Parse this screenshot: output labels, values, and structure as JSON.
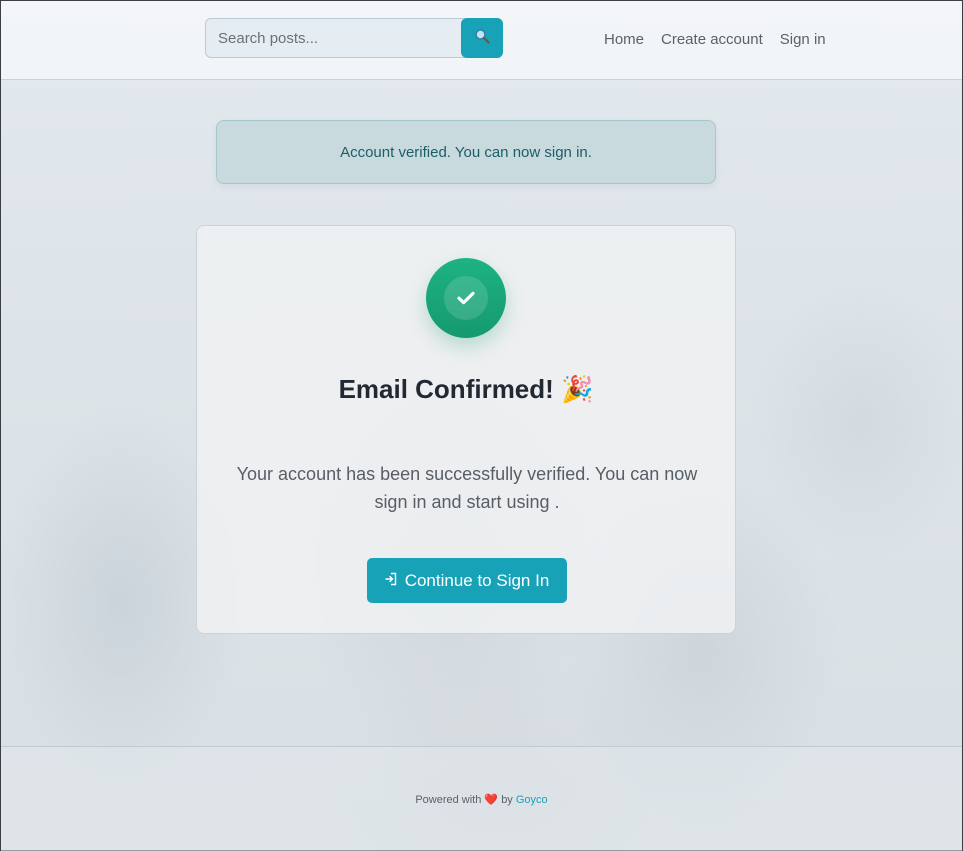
{
  "header": {
    "search": {
      "placeholder": "Search posts...",
      "button_icon": "search-icon"
    },
    "nav": [
      {
        "label": "Home"
      },
      {
        "label": "Create account"
      },
      {
        "label": "Sign in"
      }
    ]
  },
  "alert": {
    "message": "Account verified. You can now sign in."
  },
  "card": {
    "icon": "check-circle-icon",
    "title": "Email Confirmed! 🎉",
    "text": "Your account has been successfully verified. You can now sign in and start using .",
    "button": {
      "icon": "sign-in-icon",
      "label": "Continue to Sign In"
    }
  },
  "footer": {
    "powered_prefix": "Powered with",
    "heart": "❤️",
    "by": "by",
    "brand": "Goyco"
  },
  "colors": {
    "accent": "#17a2b8",
    "success": "#1aa87a",
    "alert_bg": "#c9dadf",
    "alert_text": "#1c5e66"
  }
}
